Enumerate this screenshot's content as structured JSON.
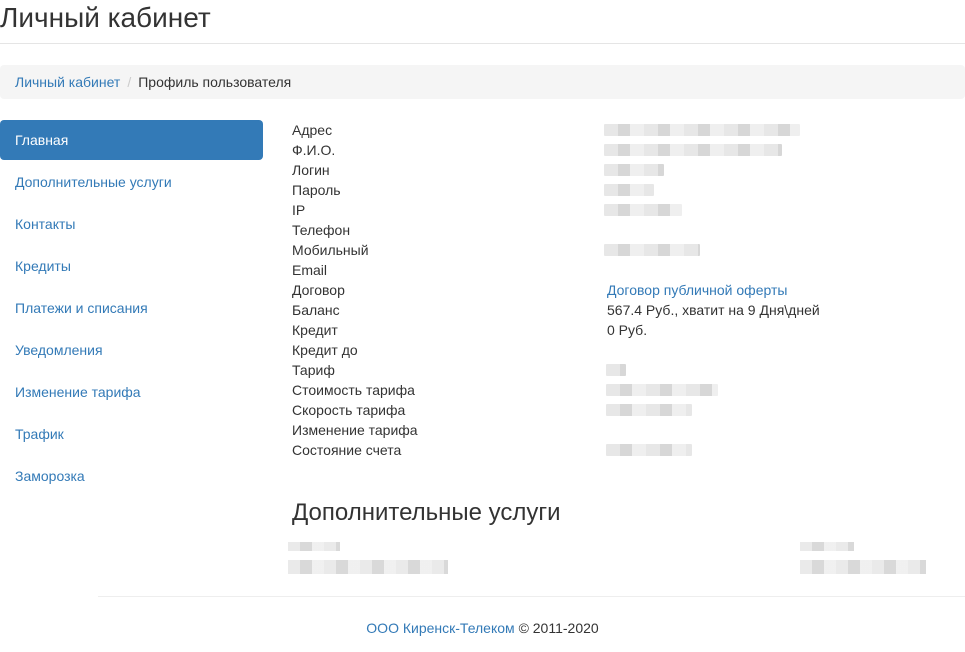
{
  "header": {
    "title": "Личный кабинет"
  },
  "breadcrumb": {
    "home": "Личный кабинет",
    "separator": "/",
    "current": "Профиль пользователя"
  },
  "sidebar": {
    "items": [
      {
        "label": "Главная",
        "active": true
      },
      {
        "label": "Дополнительные услуги"
      },
      {
        "label": "Контакты"
      },
      {
        "label": "Кредиты"
      },
      {
        "label": "Платежи и списания"
      },
      {
        "label": "Уведомления"
      },
      {
        "label": "Изменение тарифа"
      },
      {
        "label": "Трафик"
      },
      {
        "label": "Заморозка"
      }
    ]
  },
  "profile": {
    "labels": {
      "address": "Адрес",
      "fio": "Ф.И.О.",
      "login": "Логин",
      "password": "Пароль",
      "ip": "IP",
      "phone": "Телефон",
      "mobile": "Мобильный",
      "email": "Email",
      "contract": "Договор",
      "balance": "Баланс",
      "credit": "Кредит",
      "credit_until": "Кредит до",
      "tariff": "Тариф",
      "tariff_cost": "Стоимость тарифа",
      "tariff_speed": "Скорость тарифа",
      "tariff_change": "Изменение тарифа",
      "account_state": "Состояние счета"
    },
    "values": {
      "contract_link": "Договор публичной оферты",
      "balance": "567.4 Руб., хватит на 9 Дня\\дней",
      "credit": "0 Руб."
    }
  },
  "services": {
    "title": "Дополнительные услуги"
  },
  "footer": {
    "company": "ООО Киренск-Телеком",
    "copyright": "© 2011-2020"
  },
  "colors": {
    "accent": "#337ab7",
    "breadcrumb_bg": "#f5f5f5"
  }
}
